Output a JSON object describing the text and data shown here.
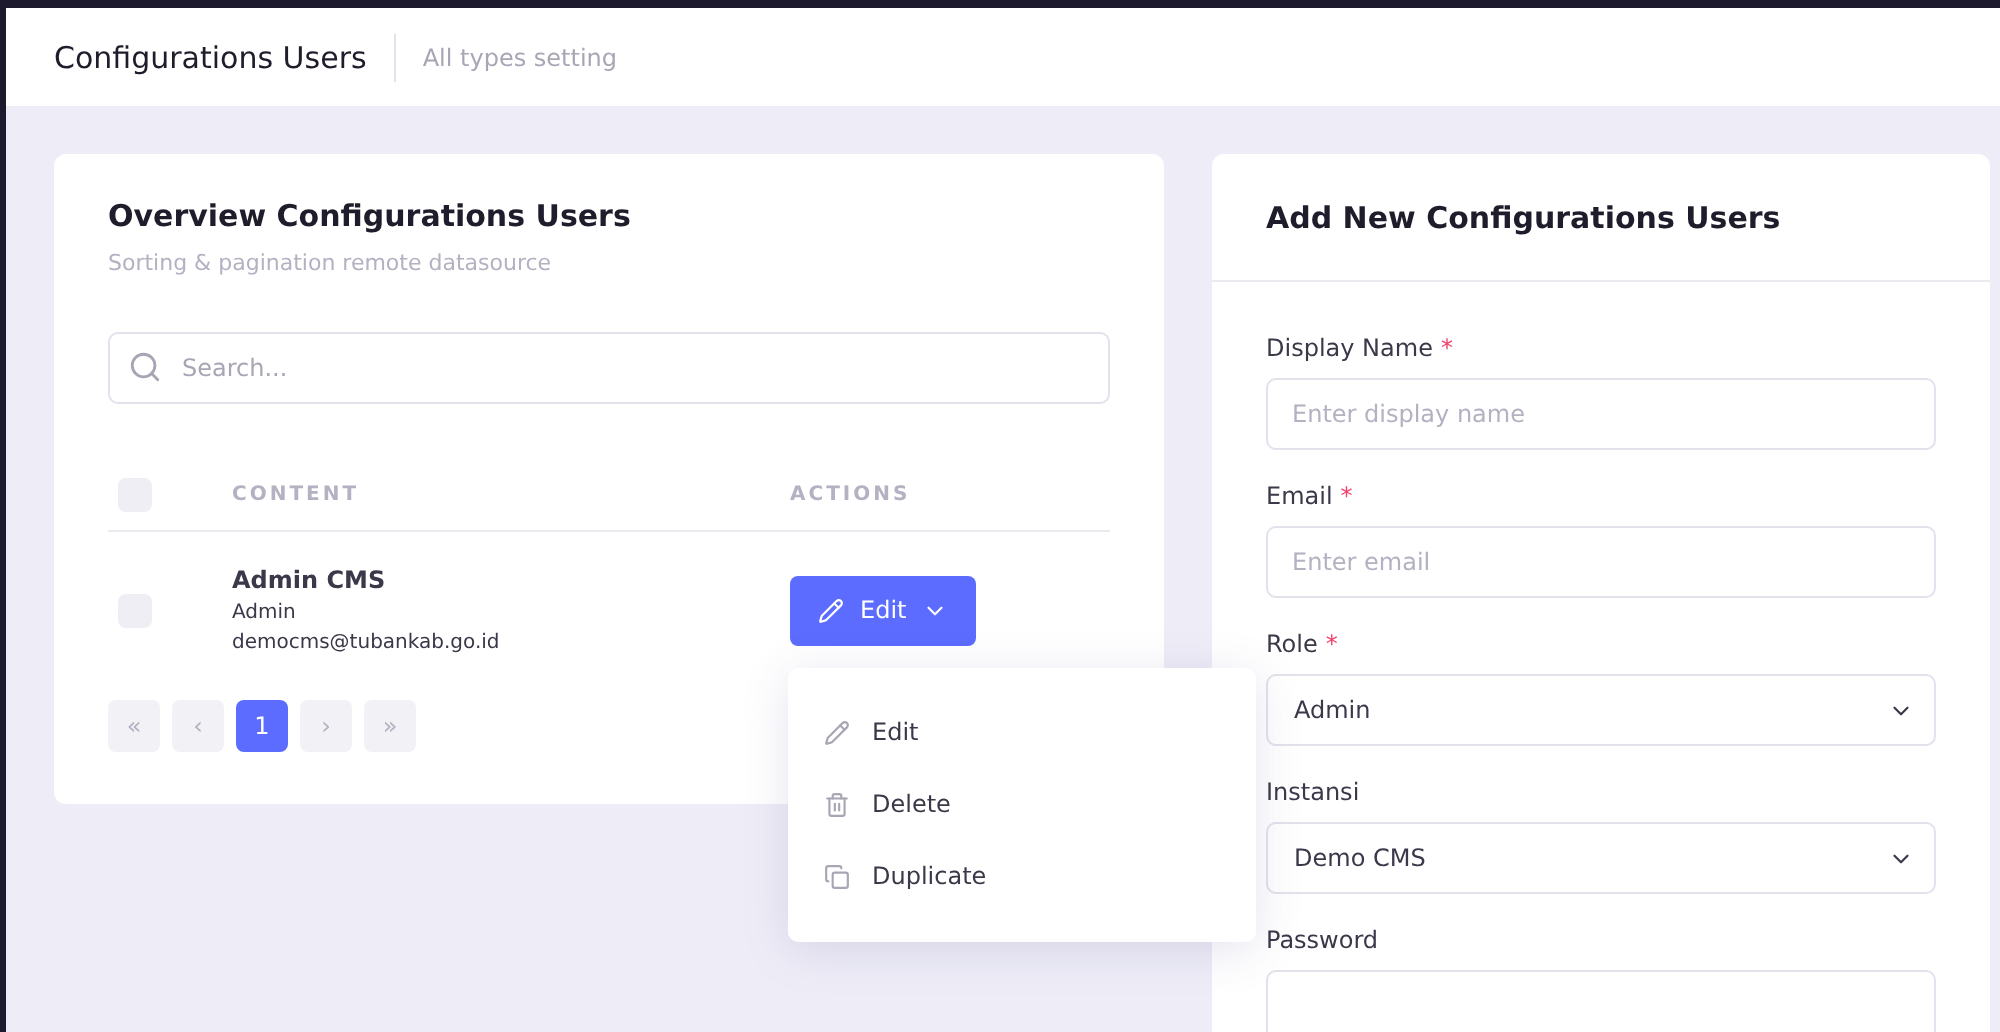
{
  "header": {
    "title": "Configurations Users",
    "subtitle": "All types setting"
  },
  "overview": {
    "title": "Overview Configurations Users",
    "subtitle": "Sorting & pagination remote datasource",
    "search": {
      "placeholder": "Search..."
    },
    "table": {
      "select_all": {
        "checked": false
      },
      "columns": [
        "CONTENT",
        "ACTIONS"
      ],
      "rows": [
        {
          "checked": false,
          "name": "Admin CMS",
          "role": "Admin",
          "email": "democms@tubankab.go.id",
          "action": "Edit"
        }
      ]
    },
    "pagination": [
      {
        "label": "«",
        "selected": false
      },
      {
        "label": "‹",
        "selected": false
      },
      {
        "label": "1",
        "selected": true
      },
      {
        "label": "›",
        "selected": false
      },
      {
        "label": "»",
        "selected": false
      }
    ],
    "menu": [
      {
        "kind": "edit",
        "label": "Edit"
      },
      {
        "kind": "delete",
        "label": "Delete"
      },
      {
        "kind": "duplicate",
        "label": "Duplicate"
      }
    ]
  },
  "form": {
    "title": "Add New Configurations Users",
    "required_mark": "*",
    "fields": [
      {
        "label": "Display Name",
        "required": true,
        "kind": "input",
        "placeholder": "Enter display name"
      },
      {
        "label": "Email",
        "required": true,
        "kind": "input",
        "placeholder": "Enter email"
      },
      {
        "label": "Role",
        "required": true,
        "kind": "select",
        "value": "Admin"
      },
      {
        "label": "Instansi",
        "required": false,
        "kind": "select",
        "value": "Demo CMS"
      },
      {
        "label": "Password",
        "required": false,
        "kind": "input"
      }
    ]
  }
}
